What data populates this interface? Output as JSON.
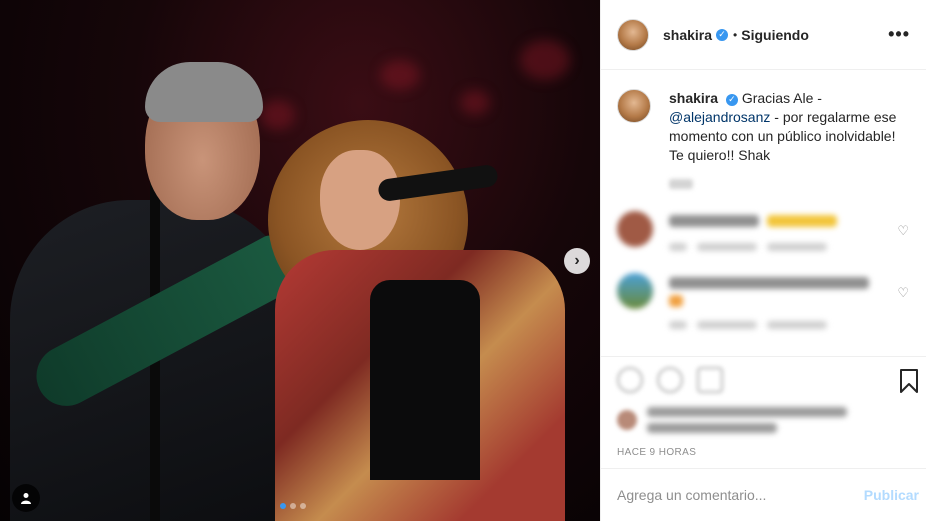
{
  "header": {
    "username": "shakira",
    "separator": "•",
    "follow_label": "Siguiendo",
    "more_label": "•••"
  },
  "caption": {
    "username": "shakira",
    "text_1": "Gracias Ale - ",
    "mention": "@alejandrosanz",
    "text_2": " - por regalarme ese momento con un público inolvidable! Te quiero!! Shak"
  },
  "photo": {
    "next_label": "›",
    "carousel_count": 3,
    "carousel_active": 0
  },
  "post_meta": {
    "time_label": "HACE 9 HORAS"
  },
  "add_comment": {
    "placeholder": "Agrega un comentario...",
    "publish_label": "Publicar"
  },
  "colors": {
    "accent_blue": "#3897f0",
    "publish_disabled": "#b3dbff",
    "text": "#262626",
    "muted": "#8e8e8e",
    "border": "#efefef"
  },
  "icons": {
    "verified": "verified-badge-icon",
    "next": "chevron-right-icon",
    "tag": "user-tag-icon",
    "heart": "heart-icon",
    "bookmark": "bookmark-icon"
  }
}
